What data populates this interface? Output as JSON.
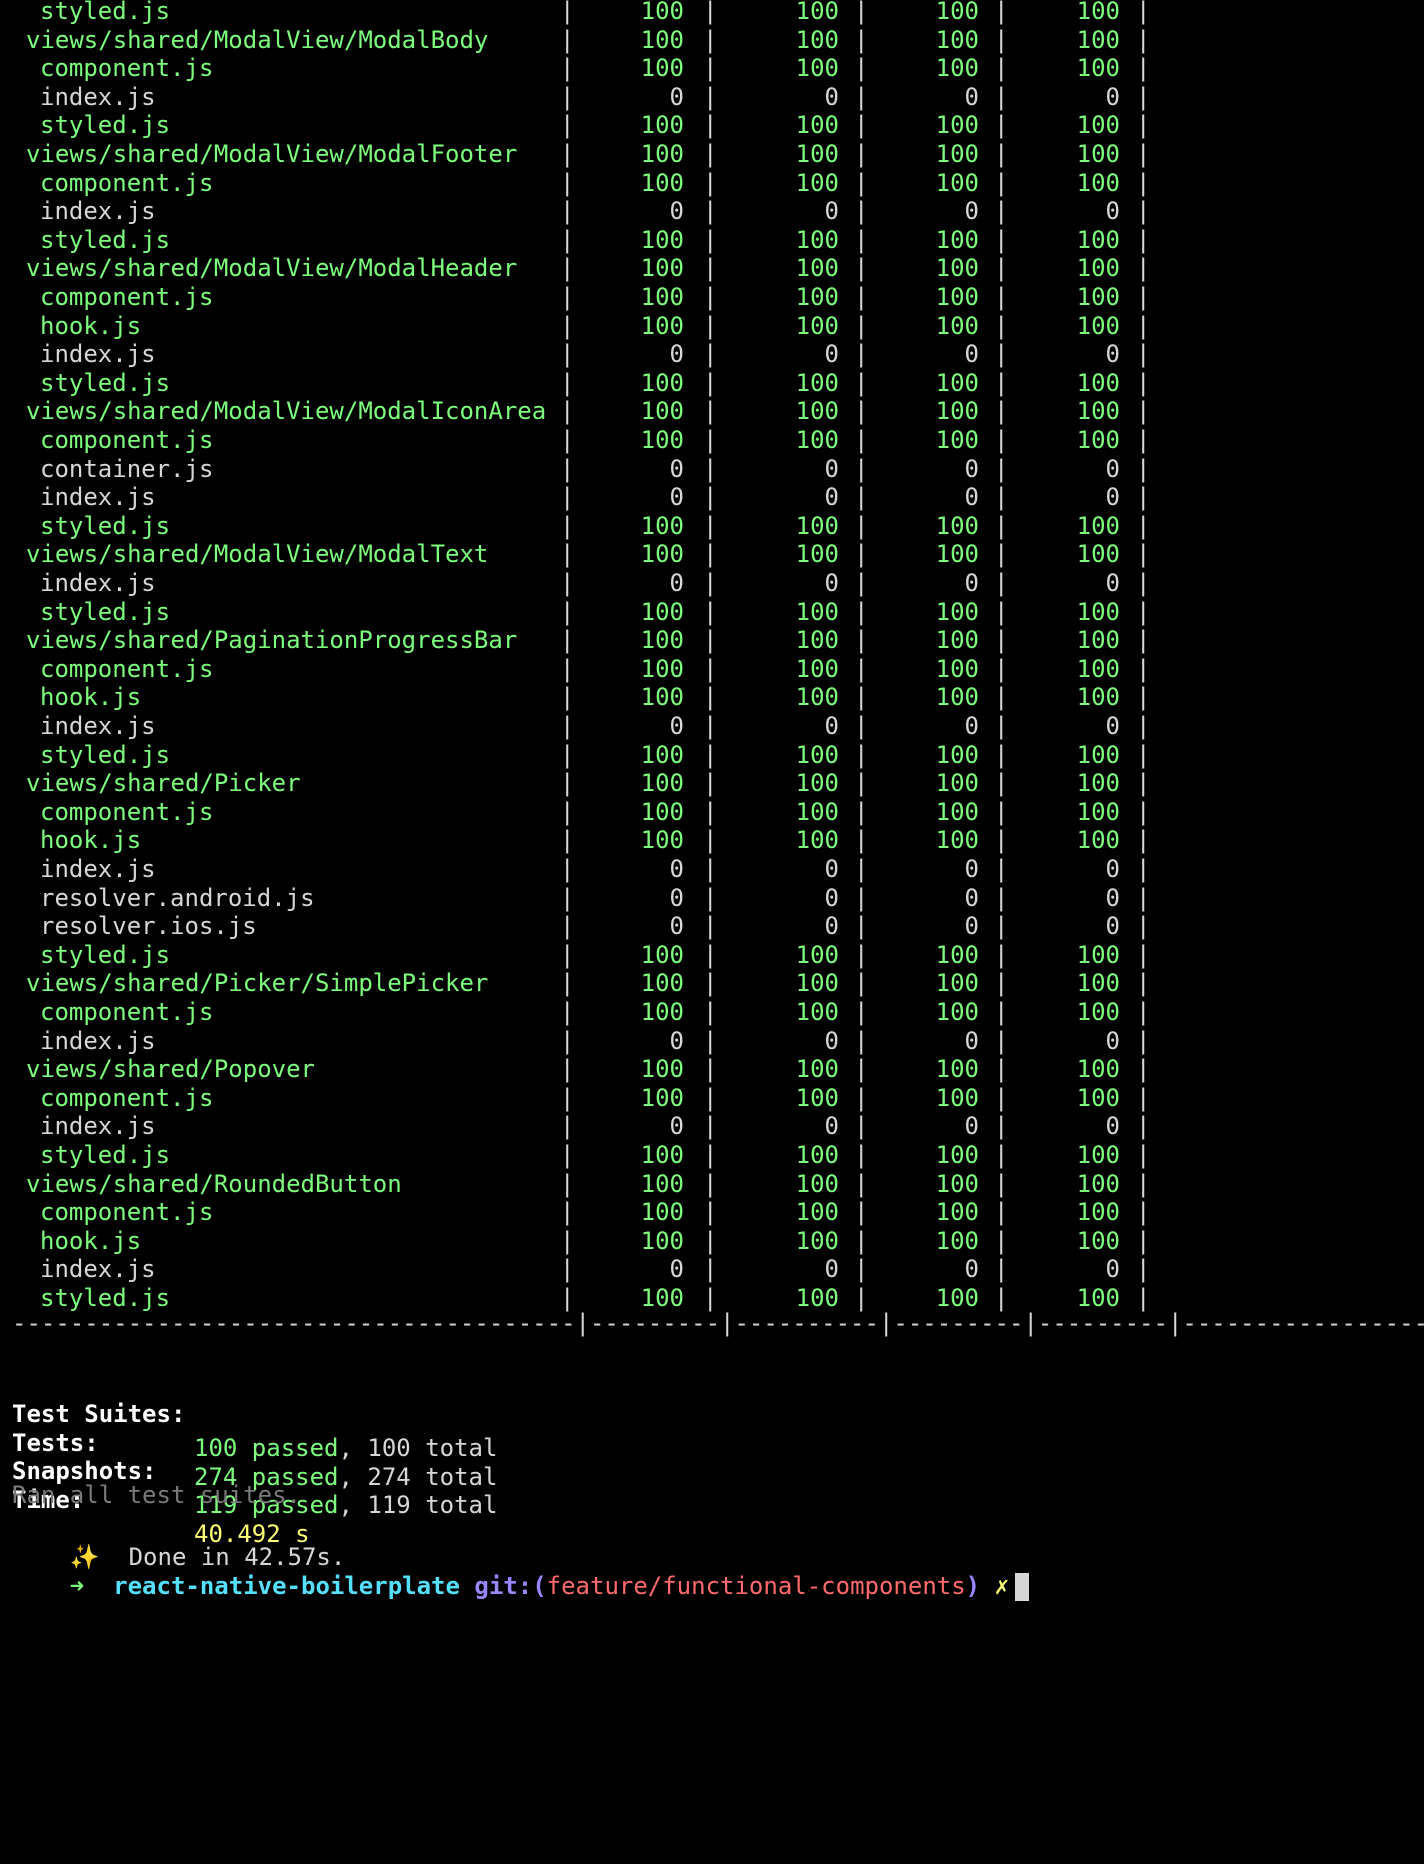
{
  "rows": [
    {
      "name": "styled.js",
      "indent": 1,
      "covered": true,
      "v": [
        "100",
        "100",
        "100",
        "100"
      ]
    },
    {
      "name": "views/shared/ModalView/ModalBody",
      "indent": 0,
      "covered": true,
      "v": [
        "100",
        "100",
        "100",
        "100"
      ]
    },
    {
      "name": "component.js",
      "indent": 1,
      "covered": true,
      "v": [
        "100",
        "100",
        "100",
        "100"
      ]
    },
    {
      "name": "index.js",
      "indent": 1,
      "covered": false,
      "v": [
        "0",
        "0",
        "0",
        "0"
      ]
    },
    {
      "name": "styled.js",
      "indent": 1,
      "covered": true,
      "v": [
        "100",
        "100",
        "100",
        "100"
      ]
    },
    {
      "name": "views/shared/ModalView/ModalFooter",
      "indent": 0,
      "covered": true,
      "v": [
        "100",
        "100",
        "100",
        "100"
      ]
    },
    {
      "name": "component.js",
      "indent": 1,
      "covered": true,
      "v": [
        "100",
        "100",
        "100",
        "100"
      ]
    },
    {
      "name": "index.js",
      "indent": 1,
      "covered": false,
      "v": [
        "0",
        "0",
        "0",
        "0"
      ]
    },
    {
      "name": "styled.js",
      "indent": 1,
      "covered": true,
      "v": [
        "100",
        "100",
        "100",
        "100"
      ]
    },
    {
      "name": "views/shared/ModalView/ModalHeader",
      "indent": 0,
      "covered": true,
      "v": [
        "100",
        "100",
        "100",
        "100"
      ]
    },
    {
      "name": "component.js",
      "indent": 1,
      "covered": true,
      "v": [
        "100",
        "100",
        "100",
        "100"
      ]
    },
    {
      "name": "hook.js",
      "indent": 1,
      "covered": true,
      "v": [
        "100",
        "100",
        "100",
        "100"
      ]
    },
    {
      "name": "index.js",
      "indent": 1,
      "covered": false,
      "v": [
        "0",
        "0",
        "0",
        "0"
      ]
    },
    {
      "name": "styled.js",
      "indent": 1,
      "covered": true,
      "v": [
        "100",
        "100",
        "100",
        "100"
      ]
    },
    {
      "name": "views/shared/ModalView/ModalIconArea",
      "indent": 0,
      "covered": true,
      "v": [
        "100",
        "100",
        "100",
        "100"
      ]
    },
    {
      "name": "component.js",
      "indent": 1,
      "covered": true,
      "v": [
        "100",
        "100",
        "100",
        "100"
      ]
    },
    {
      "name": "container.js",
      "indent": 1,
      "covered": false,
      "v": [
        "0",
        "0",
        "0",
        "0"
      ]
    },
    {
      "name": "index.js",
      "indent": 1,
      "covered": false,
      "v": [
        "0",
        "0",
        "0",
        "0"
      ]
    },
    {
      "name": "styled.js",
      "indent": 1,
      "covered": true,
      "v": [
        "100",
        "100",
        "100",
        "100"
      ]
    },
    {
      "name": "views/shared/ModalView/ModalText",
      "indent": 0,
      "covered": true,
      "v": [
        "100",
        "100",
        "100",
        "100"
      ]
    },
    {
      "name": "index.js",
      "indent": 1,
      "covered": false,
      "v": [
        "0",
        "0",
        "0",
        "0"
      ]
    },
    {
      "name": "styled.js",
      "indent": 1,
      "covered": true,
      "v": [
        "100",
        "100",
        "100",
        "100"
      ]
    },
    {
      "name": "views/shared/PaginationProgressBar",
      "indent": 0,
      "covered": true,
      "v": [
        "100",
        "100",
        "100",
        "100"
      ]
    },
    {
      "name": "component.js",
      "indent": 1,
      "covered": true,
      "v": [
        "100",
        "100",
        "100",
        "100"
      ]
    },
    {
      "name": "hook.js",
      "indent": 1,
      "covered": true,
      "v": [
        "100",
        "100",
        "100",
        "100"
      ]
    },
    {
      "name": "index.js",
      "indent": 1,
      "covered": false,
      "v": [
        "0",
        "0",
        "0",
        "0"
      ]
    },
    {
      "name": "styled.js",
      "indent": 1,
      "covered": true,
      "v": [
        "100",
        "100",
        "100",
        "100"
      ]
    },
    {
      "name": "views/shared/Picker",
      "indent": 0,
      "covered": true,
      "v": [
        "100",
        "100",
        "100",
        "100"
      ]
    },
    {
      "name": "component.js",
      "indent": 1,
      "covered": true,
      "v": [
        "100",
        "100",
        "100",
        "100"
      ]
    },
    {
      "name": "hook.js",
      "indent": 1,
      "covered": true,
      "v": [
        "100",
        "100",
        "100",
        "100"
      ]
    },
    {
      "name": "index.js",
      "indent": 1,
      "covered": false,
      "v": [
        "0",
        "0",
        "0",
        "0"
      ]
    },
    {
      "name": "resolver.android.js",
      "indent": 1,
      "covered": false,
      "v": [
        "0",
        "0",
        "0",
        "0"
      ]
    },
    {
      "name": "resolver.ios.js",
      "indent": 1,
      "covered": false,
      "v": [
        "0",
        "0",
        "0",
        "0"
      ]
    },
    {
      "name": "styled.js",
      "indent": 1,
      "covered": true,
      "v": [
        "100",
        "100",
        "100",
        "100"
      ]
    },
    {
      "name": "views/shared/Picker/SimplePicker",
      "indent": 0,
      "covered": true,
      "v": [
        "100",
        "100",
        "100",
        "100"
      ]
    },
    {
      "name": "component.js",
      "indent": 1,
      "covered": true,
      "v": [
        "100",
        "100",
        "100",
        "100"
      ]
    },
    {
      "name": "index.js",
      "indent": 1,
      "covered": false,
      "v": [
        "0",
        "0",
        "0",
        "0"
      ]
    },
    {
      "name": "views/shared/Popover",
      "indent": 0,
      "covered": true,
      "v": [
        "100",
        "100",
        "100",
        "100"
      ]
    },
    {
      "name": "component.js",
      "indent": 1,
      "covered": true,
      "v": [
        "100",
        "100",
        "100",
        "100"
      ]
    },
    {
      "name": "index.js",
      "indent": 1,
      "covered": false,
      "v": [
        "0",
        "0",
        "0",
        "0"
      ]
    },
    {
      "name": "styled.js",
      "indent": 1,
      "covered": true,
      "v": [
        "100",
        "100",
        "100",
        "100"
      ]
    },
    {
      "name": "views/shared/RoundedButton",
      "indent": 0,
      "covered": true,
      "v": [
        "100",
        "100",
        "100",
        "100"
      ]
    },
    {
      "name": "component.js",
      "indent": 1,
      "covered": true,
      "v": [
        "100",
        "100",
        "100",
        "100"
      ]
    },
    {
      "name": "hook.js",
      "indent": 1,
      "covered": true,
      "v": [
        "100",
        "100",
        "100",
        "100"
      ]
    },
    {
      "name": "index.js",
      "indent": 1,
      "covered": false,
      "v": [
        "0",
        "0",
        "0",
        "0"
      ]
    },
    {
      "name": "styled.js",
      "indent": 1,
      "covered": true,
      "v": [
        "100",
        "100",
        "100",
        "100"
      ]
    }
  ],
  "separator": "---------------------------------------|---------|----------|---------|---------|-------------------",
  "summary": {
    "suites": {
      "label": "Test Suites:",
      "passed": "100 passed",
      "rest": ", 100 total"
    },
    "tests": {
      "label": "Tests:",
      "passed": "274 passed",
      "rest": ", 274 total"
    },
    "snapshots": {
      "label": "Snapshots:",
      "passed": "119 passed",
      "rest": ", 119 total"
    },
    "time": {
      "label": "Time:",
      "value": "40.492 s"
    }
  },
  "ran_all": "Ran all test suites.",
  "done": {
    "icon": "✨",
    "text": "Done in 42.57s."
  },
  "prompt": {
    "arrow": "➜",
    "dir": "react-native-boilerplate",
    "git_prefix": "git:(",
    "branch": "feature/functional-components",
    "git_suffix": ")",
    "dirty": "✗"
  },
  "colors": {
    "background": "#000000",
    "green": "#7dff7d",
    "text": "#d7d7d7",
    "yellow": "#ffff73",
    "gray": "#7a7a7a",
    "cyan": "#56e0ff",
    "purple": "#9a86ff",
    "red": "#ff6b6b"
  }
}
